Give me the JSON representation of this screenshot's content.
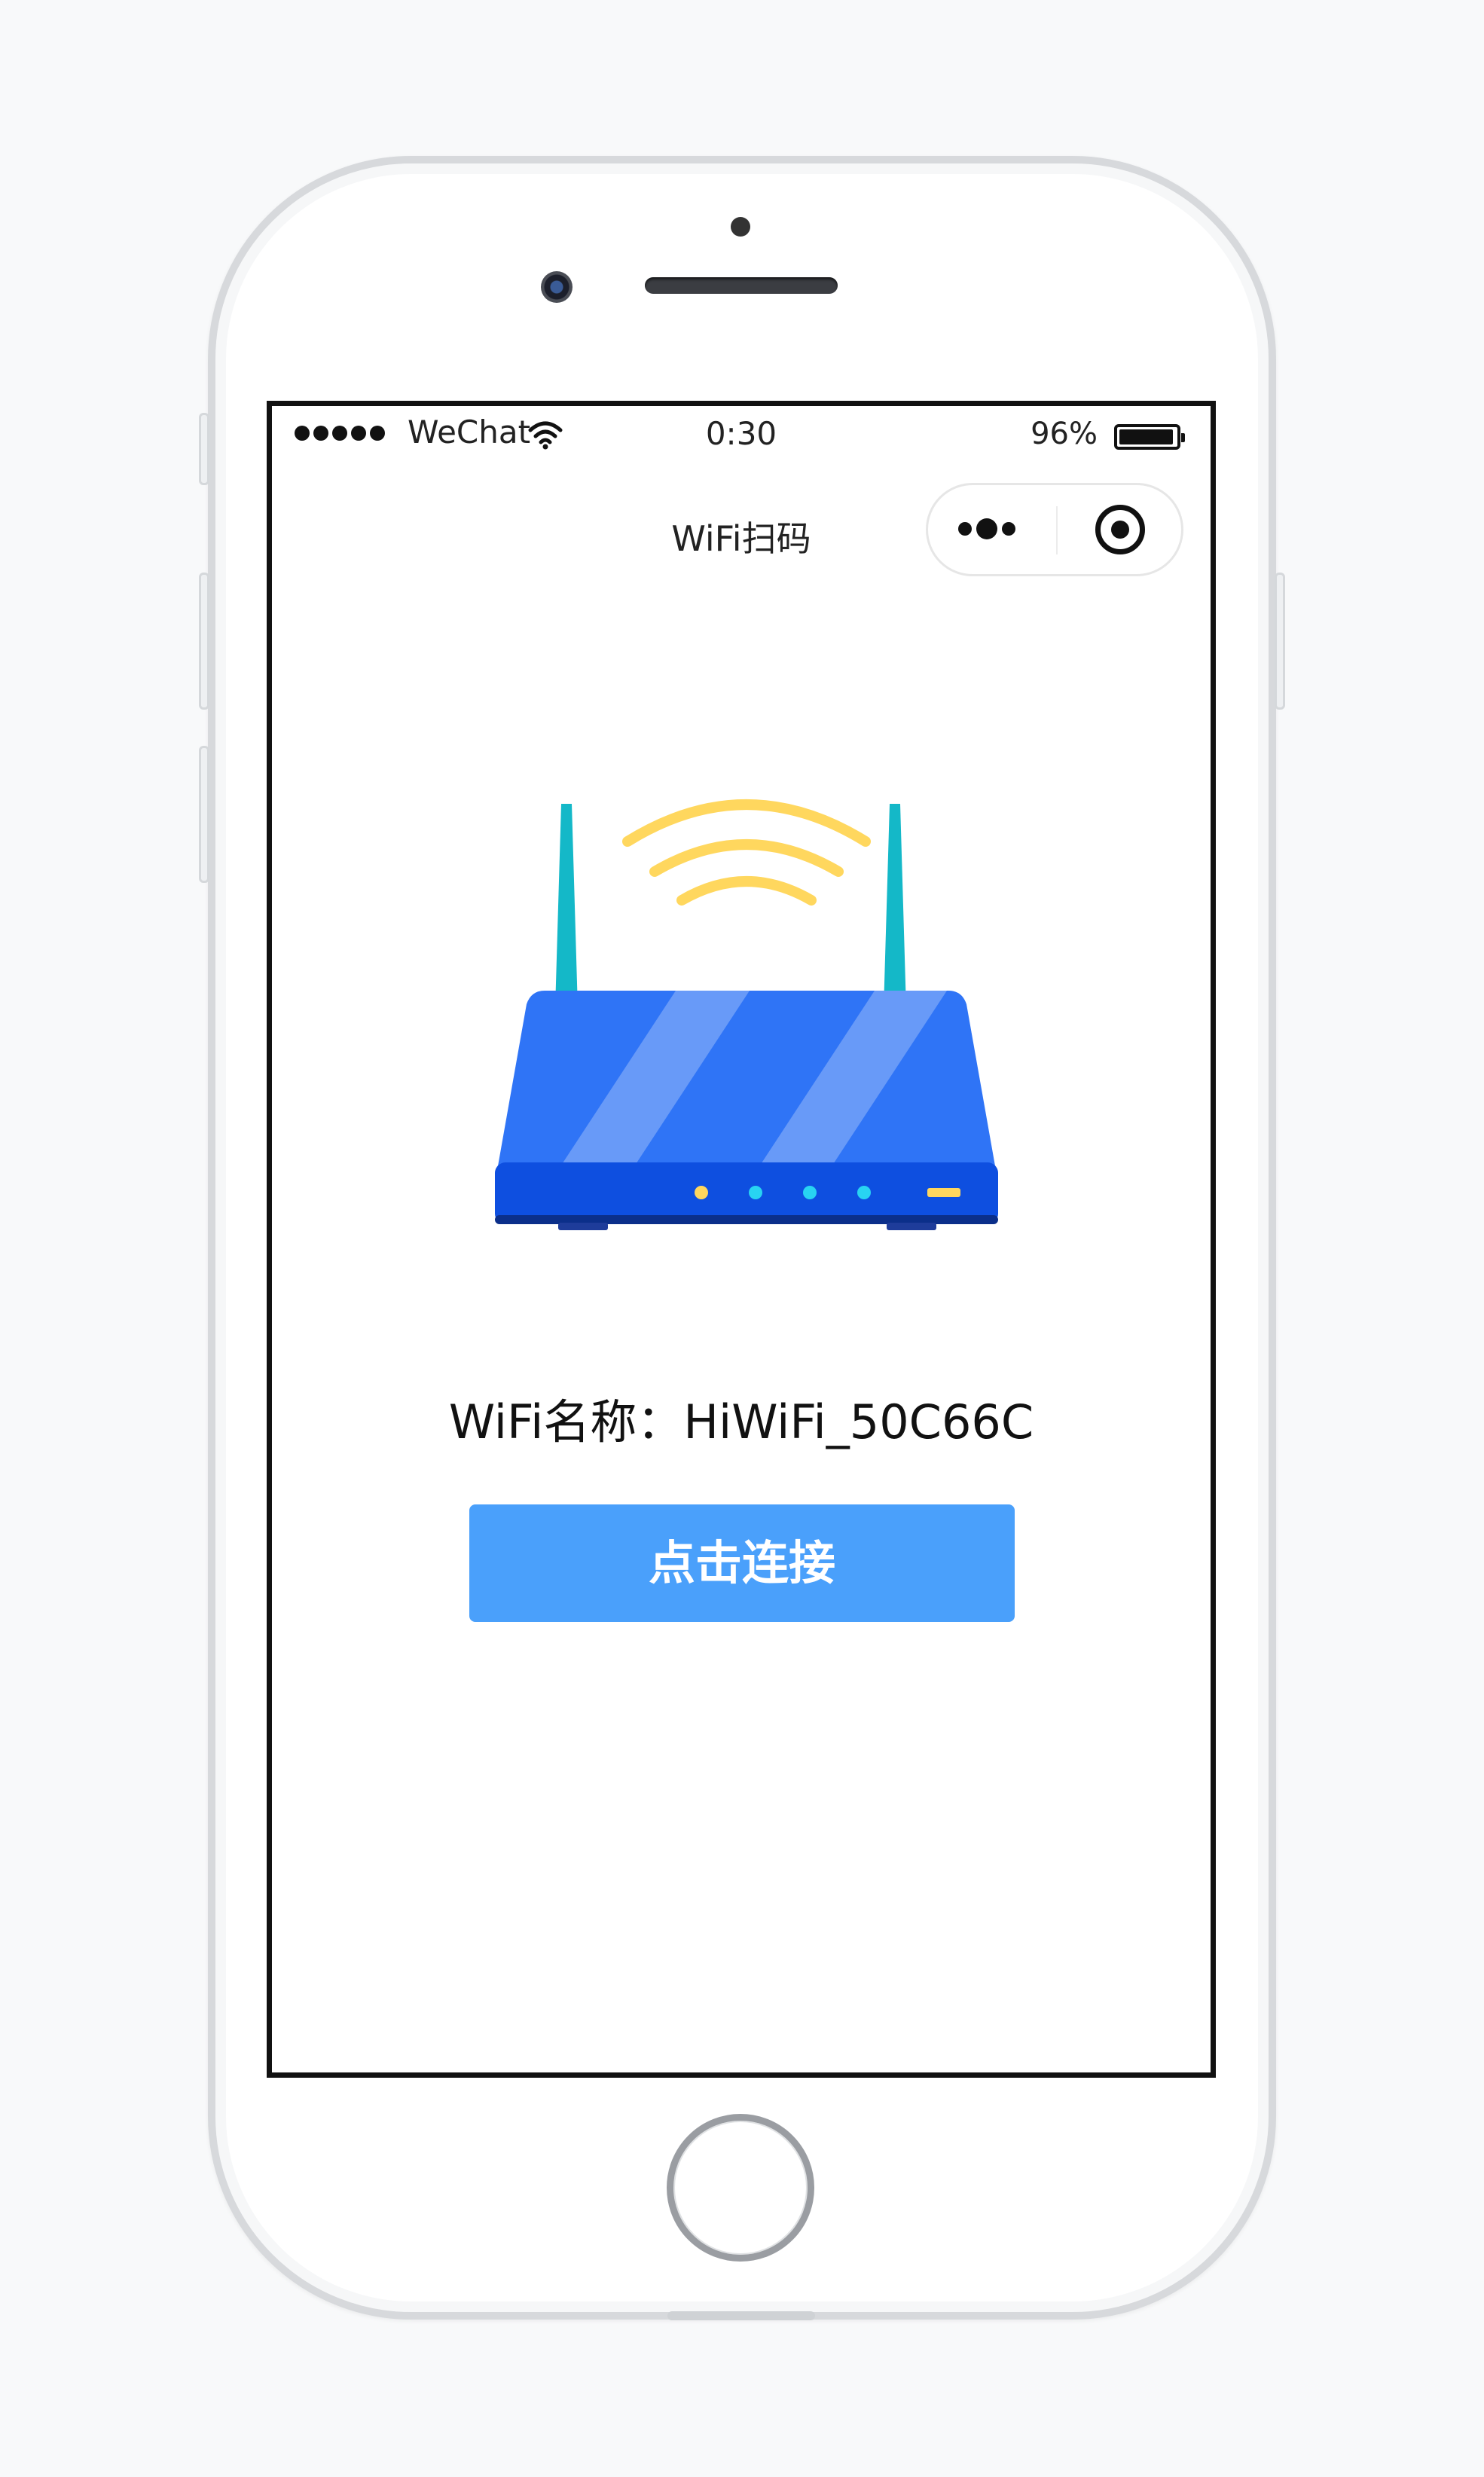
{
  "status_bar": {
    "carrier": "WeChat",
    "time": "0:30",
    "battery_percent": "96%",
    "battery_level": 0.96,
    "signal_bars": 5
  },
  "nav": {
    "title": "WiFi扫码"
  },
  "main": {
    "wifi_name_text": "WiFi名称：HiWiFi_50C66C",
    "connect_button_label": "点击连接"
  },
  "colors": {
    "router_body": "#2f74f6",
    "router_base": "#0e4fe0",
    "antenna": "#14b8c8",
    "wifi_waves": "#ffd75e",
    "button": "#4aa0fb"
  },
  "icons": {
    "status": [
      "signal-icon",
      "wifi-icon",
      "battery-icon"
    ],
    "capsule": [
      "more-icon",
      "close-icon"
    ],
    "illustration": "router-illustration"
  }
}
